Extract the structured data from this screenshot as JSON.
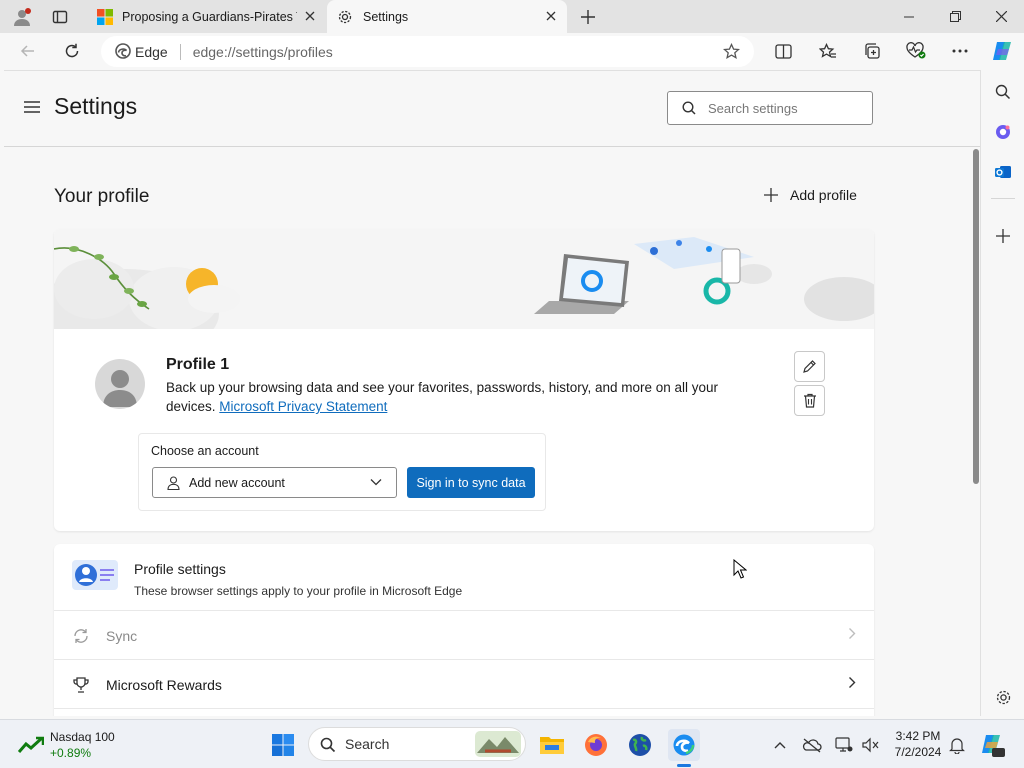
{
  "tabs": [
    {
      "title": "Proposing a Guardians-Pirates Tr",
      "icon": "microsoft-logo"
    },
    {
      "title": "Settings",
      "icon": "gear-icon",
      "active": true
    }
  ],
  "address": {
    "brand": "Edge",
    "url": "edge://settings/profiles"
  },
  "settings": {
    "title": "Settings",
    "search_placeholder": "Search settings",
    "profile_heading": "Your profile",
    "add_profile": "Add profile",
    "profile": {
      "name": "Profile 1",
      "description": "Back up your browsing data and see your favorites, passwords, history, and more on all your devices.",
      "privacy_link": "Microsoft Privacy Statement"
    },
    "account": {
      "label": "Choose an account",
      "dropdown_value": "Add new account",
      "sign_in_button": "Sign in to sync data"
    },
    "profile_settings": {
      "title": "Profile settings",
      "subtitle": "These browser settings apply to your profile in Microsoft Edge"
    },
    "rows": [
      {
        "label": "Sync",
        "disabled": true
      },
      {
        "label": "Microsoft Rewards",
        "disabled": false
      }
    ]
  },
  "taskbar": {
    "widget_title": "Nasdaq 100",
    "widget_value": "+0.89%",
    "search_label": "Search",
    "time": "3:42 PM",
    "date": "7/2/2024"
  },
  "colors": {
    "accent": "#0f6cbd",
    "positive": "#107c10"
  }
}
